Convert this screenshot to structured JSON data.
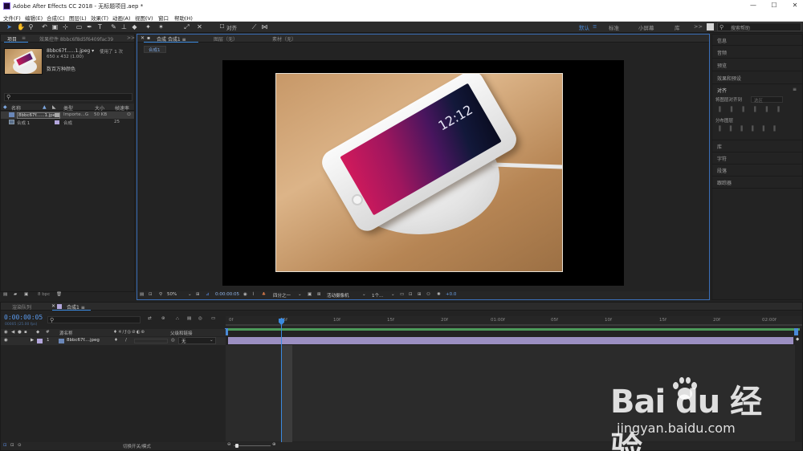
{
  "window": {
    "title": "Adobe After Effects CC 2018 - 无标题项目.aep *",
    "controls": [
      "—",
      "☐",
      "✕"
    ]
  },
  "menu": [
    "文件(F)",
    "编辑(E)",
    "合成(C)",
    "图层(L)",
    "效果(T)",
    "动画(A)",
    "视图(V)",
    "窗口",
    "帮助(H)"
  ],
  "toolbar": {
    "snap_label": "对齐",
    "workspaces": [
      "默认",
      "标准",
      "小屏幕",
      "库"
    ],
    "search_placeholder": "搜索帮助",
    "expand": ">>"
  },
  "project": {
    "tab_label": "项目",
    "effects_tab_label": "效果控件 8bbc6f8d5f6409fac39",
    "expand": ">>",
    "thumb_name": "8bbc67f......1.jpeg ▾",
    "usage": "使用了 1 次",
    "dims": "650 x 432 (1.00)",
    "color_note": "数百万种颜色",
    "search_placeholder": "",
    "columns": [
      "名称",
      "类型",
      "大小",
      "帧速率"
    ],
    "items": [
      {
        "name": "8bbc67f......1.jpeg",
        "type": "Importe...G",
        "size": "50 KB",
        "fps": ""
      },
      {
        "name": "合成 1",
        "type": "合成",
        "size": "",
        "fps": "25"
      }
    ],
    "bpc": "8 bpc"
  },
  "viewer": {
    "tabs": [
      "合成 合成1 ≡",
      "图层（无）",
      "素材（无）"
    ],
    "comp_crumb": "合成1",
    "zoom": "50%",
    "timecode": "0:00:00:05",
    "resolution": "四分之一",
    "camera": "活动摄像机",
    "views": "1个...",
    "exposure": "+0.0"
  },
  "right_panel": {
    "items": [
      "信息",
      "音频",
      "预览",
      "效果和预设"
    ],
    "align": {
      "title": "对齐",
      "align_to_label": "将图层对齐到",
      "align_to_value": "选区",
      "distribute_label": "分布图层"
    },
    "lower_items": [
      "库",
      "字符",
      "段落",
      "跟踪器"
    ]
  },
  "timeline": {
    "tabs": [
      "渲染队列",
      "合成1 ≡"
    ],
    "timecode": "0:00:00:05",
    "frame_info": "00005 (25.00 fps)",
    "columns": [
      "源名称",
      "父级和链接"
    ],
    "layer": {
      "index": "1",
      "name": "8bbc67f....jpeg",
      "parent": "无"
    },
    "ruler": [
      "0f",
      "05f",
      "10f",
      "15f",
      "20f",
      "01:00f",
      "05f",
      "10f",
      "15f",
      "20f",
      "02:00f"
    ],
    "footer_toggle": "切换开关/模式"
  },
  "colors": {
    "accent": "#3b8ae0",
    "layer_swatch": "#b3a6dc",
    "green_bar": "#4c9a5a"
  },
  "watermark": {
    "brand": "Bai du 经验",
    "url": "jingyan.baidu.com"
  }
}
